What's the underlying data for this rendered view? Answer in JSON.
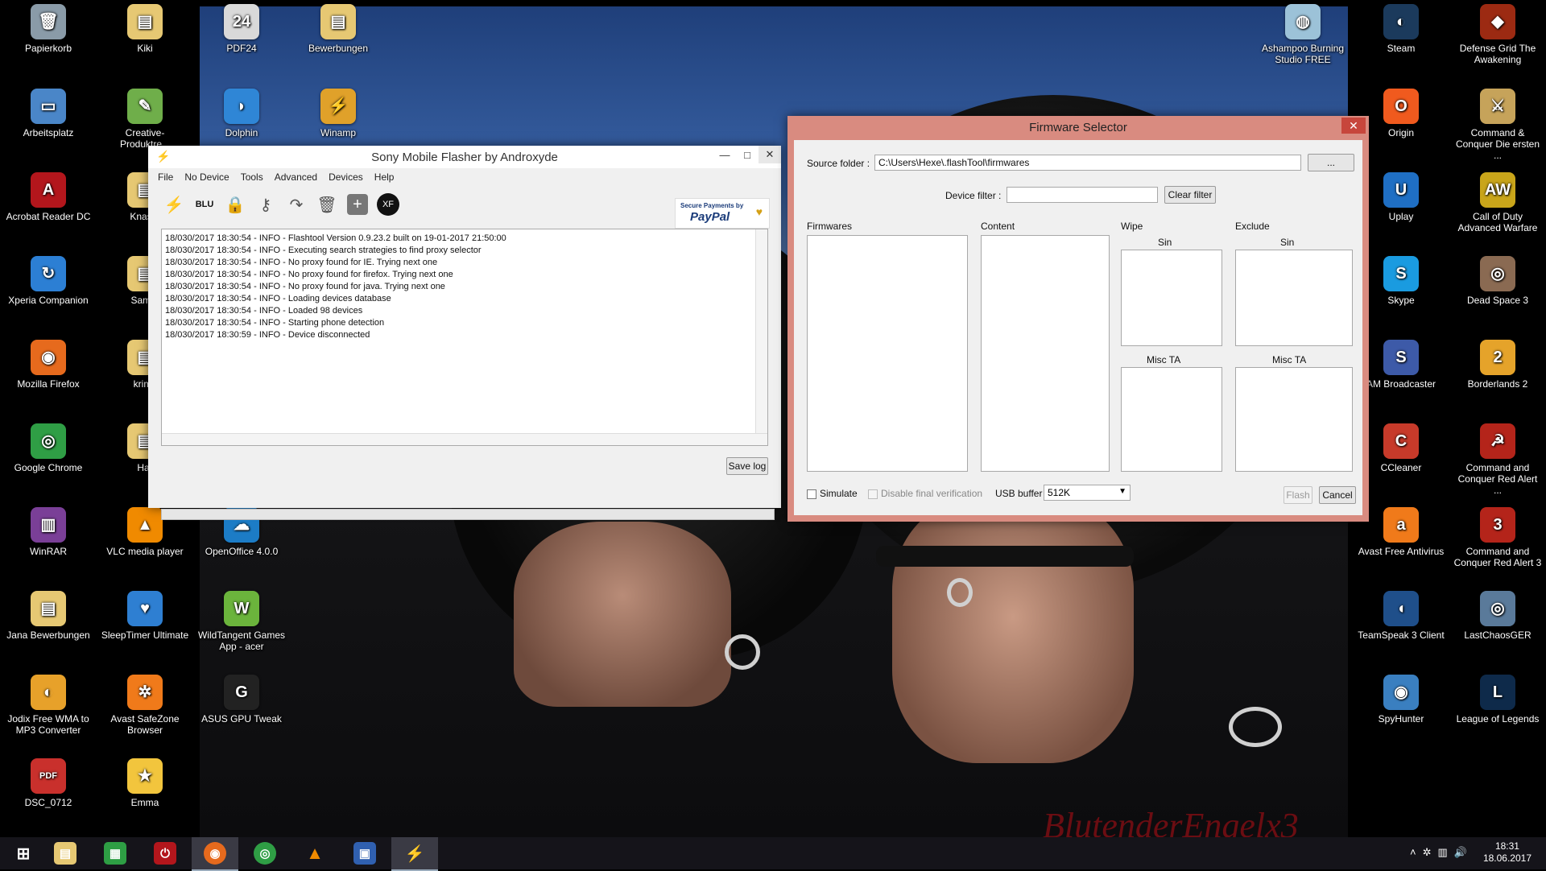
{
  "colors": {
    "accent": "#3d78d6",
    "fw_frame": "#d98b80",
    "close_red": "#c7463c",
    "taskbar": "#15141a"
  },
  "desktop": {
    "watermark": "BlutenderEngelx3",
    "icons_left": [
      {
        "label": "Papierkorb",
        "icon": "recycle-bin-icon",
        "color": "#8a9ba8",
        "glyph": "🗑"
      },
      {
        "label": "Kiki",
        "icon": "folder-icon",
        "color": "#e6c873",
        "glyph": "▤"
      },
      {
        "label": "PDF24",
        "icon": "pdf24-icon",
        "color": "#d9d9d9",
        "glyph": "24"
      },
      {
        "label": "Bewerbungen",
        "icon": "folder-icon",
        "color": "#e6c873",
        "glyph": "▤"
      },
      {
        "label": "Arbeitsplatz",
        "icon": "computer-icon",
        "color": "#4a86c8",
        "glyph": "▭"
      },
      {
        "label": "Creative-Produktre...",
        "icon": "creative-icon",
        "color": "#6fae4a",
        "glyph": "✎"
      },
      {
        "label": "Dolphin",
        "icon": "dolphin-icon",
        "color": "#2f86d6",
        "glyph": "◗"
      },
      {
        "label": "Winamp",
        "icon": "winamp-icon",
        "color": "#e0a12a",
        "glyph": "⚡"
      },
      {
        "label": "Acrobat Reader DC",
        "icon": "acrobat-icon",
        "color": "#b3161c",
        "glyph": "A"
      },
      {
        "label": "Knaste",
        "icon": "folder-icon",
        "color": "#e6c873",
        "glyph": "▤"
      },
      {
        "label": "Xperia Companion",
        "icon": "xperia-icon",
        "color": "#2c7fd4",
        "glyph": "↻"
      },
      {
        "label": "Sam T",
        "icon": "folder-icon",
        "color": "#e6c873",
        "glyph": "▤"
      },
      {
        "label": "Mozilla Firefox",
        "icon": "firefox-icon",
        "color": "#e66a1d",
        "glyph": "◉"
      },
      {
        "label": "krims",
        "icon": "folder-icon",
        "color": "#e6c873",
        "glyph": "▤"
      },
      {
        "label": "Google Chrome",
        "icon": "chrome-icon",
        "color": "#2f9e45",
        "glyph": "◎"
      },
      {
        "label": "Har",
        "icon": "folder-icon",
        "color": "#e6c873",
        "glyph": "▤"
      },
      {
        "label": "WinRAR",
        "icon": "winrar-icon",
        "color": "#7a3f97",
        "glyph": "▥"
      },
      {
        "label": "VLC media player",
        "icon": "vlc-icon",
        "color": "#f08a00",
        "glyph": "▲"
      },
      {
        "label": "OpenOffice 4.0.0",
        "icon": "openoffice-icon",
        "color": "#1c7cc6",
        "glyph": "☁"
      },
      {
        "label": "Jana Bewerbungen",
        "icon": "folder-icon",
        "color": "#e6c873",
        "glyph": "▤"
      },
      {
        "label": "SleepTimer Ultimate",
        "icon": "sleeptimer-icon",
        "color": "#2e7fd2",
        "glyph": "♥"
      },
      {
        "label": "WildTangent Games App - acer",
        "icon": "wildtangent-icon",
        "color": "#6bb43c",
        "glyph": "W"
      },
      {
        "label": "Jodix Free WMA to MP3 Converter",
        "icon": "jodix-icon",
        "color": "#e7a12a",
        "glyph": "◐"
      },
      {
        "label": "Avast SafeZone Browser",
        "icon": "avast-safezone-icon",
        "color": "#f07a1a",
        "glyph": "✲"
      },
      {
        "label": "ASUS GPU Tweak",
        "icon": "gpu-tweak-icon",
        "color": "#222222",
        "glyph": "G"
      },
      {
        "label": "DSC_0712",
        "icon": "pdf-file-icon",
        "color": "#c9302c",
        "glyph": "PDF"
      },
      {
        "label": "Emma",
        "icon": "emma-icon",
        "color": "#f2c53d",
        "glyph": "★"
      }
    ],
    "icons_right": [
      {
        "label": "Ashampoo Burning Studio FREE",
        "icon": "ashampoo-icon",
        "color": "#9cc2d8",
        "glyph": "◍"
      },
      {
        "label": "Steam",
        "icon": "steam-icon",
        "color": "#1b3a5c",
        "glyph": "◐"
      },
      {
        "label": "Defense Grid The Awakening",
        "icon": "defense-grid-icon",
        "color": "#9c2a12",
        "glyph": "◆"
      },
      {
        "label": "Origin",
        "icon": "origin-icon",
        "color": "#f05a1e",
        "glyph": "O"
      },
      {
        "label": "Command & Conquer Die ersten ...",
        "icon": "cnc-icon",
        "color": "#c6a35a",
        "glyph": "⚔"
      },
      {
        "label": "Uplay",
        "icon": "uplay-icon",
        "color": "#1f6fc4",
        "glyph": "U"
      },
      {
        "label": "Call of Duty Advanced Warfare",
        "icon": "cod-icon",
        "color": "#c9a51a",
        "glyph": "AW"
      },
      {
        "label": "Skype",
        "icon": "skype-icon",
        "color": "#1a9be0",
        "glyph": "S"
      },
      {
        "label": "Dead Space 3",
        "icon": "deadspace-icon",
        "color": "#8a6a52",
        "glyph": "◎"
      },
      {
        "label": "AM Broadcaster",
        "icon": "broadcaster-icon",
        "color": "#3d5aa8",
        "glyph": "S"
      },
      {
        "label": "Borderlands 2",
        "icon": "borderlands-icon",
        "color": "#e5a32a",
        "glyph": "2"
      },
      {
        "label": "CCleaner",
        "icon": "ccleaner-icon",
        "color": "#c73a2a",
        "glyph": "C"
      },
      {
        "label": "Command and Conquer Red Alert ...",
        "icon": "red-alert-icon",
        "color": "#b4241a",
        "glyph": "☭"
      },
      {
        "label": "Avast Free Antivirus",
        "icon": "avast-icon",
        "color": "#f07a1a",
        "glyph": "a"
      },
      {
        "label": "Command and Conquer Red Alert 3",
        "icon": "red-alert3-icon",
        "color": "#b4241a",
        "glyph": "3"
      },
      {
        "label": "TeamSpeak 3 Client",
        "icon": "teamspeak-icon",
        "color": "#1f4f8a",
        "glyph": "◖"
      },
      {
        "label": "LastChaosGER",
        "icon": "lastchaos-icon",
        "color": "#5a7a9a",
        "glyph": "◎"
      },
      {
        "label": "SpyHunter",
        "icon": "spyhunter-icon",
        "color": "#3a7fc0",
        "glyph": "◉"
      },
      {
        "label": "League of Legends",
        "icon": "lol-icon",
        "color": "#0e2a4a",
        "glyph": "L"
      }
    ]
  },
  "flasher": {
    "title": "Sony Mobile Flasher by Androxyde",
    "app_icon": "flash-icon",
    "menu": [
      "File",
      "No Device",
      "Tools",
      "Advanced",
      "Devices",
      "Help"
    ],
    "toolbar": [
      "flash-icon",
      "blu-icon",
      "lock-icon",
      "key-icon",
      "arrow-icon",
      "trash-icon",
      "plus-icon",
      "xperifirm-icon"
    ],
    "blu_label": "BLU",
    "paypal_top": "Secure Payments by",
    "paypal_brand": "PayPal",
    "log": [
      "18/030/2017 18:30:54 - INFO  - Flashtool Version 0.9.23.2 built on 19-01-2017 21:50:00",
      "18/030/2017 18:30:54 - INFO  - Executing search strategies to find proxy selector",
      "18/030/2017 18:30:54 - INFO  - No proxy found for IE. Trying next one",
      "18/030/2017 18:30:54 - INFO  - No proxy found for firefox. Trying next one",
      "18/030/2017 18:30:54 - INFO  - No proxy found for java. Trying next one",
      "18/030/2017 18:30:54 - INFO  - Loading devices database",
      "18/030/2017 18:30:54 - INFO  - Loaded 98 devices",
      "18/030/2017 18:30:54 - INFO  - Starting phone detection",
      "18/030/2017 18:30:59 - INFO  - Device disconnected"
    ],
    "save_log": "Save log"
  },
  "firmware": {
    "title": "Firmware Selector",
    "source_label": "Source folder :",
    "source_value": "C:\\Users\\Hexe\\.flashTool\\firmwares",
    "browse": "...",
    "filter_label": "Device filter :",
    "filter_value": "",
    "clear_filter": "Clear filter",
    "firmwares": "Firmwares",
    "content": "Content",
    "wipe": "Wipe",
    "exclude": "Exclude",
    "sin": "Sin",
    "misc_ta": "Misc TA",
    "simulate": "Simulate",
    "disable_verif": "Disable final verification",
    "usb_buffer": "USB buffer",
    "usb_value": "512K",
    "flash": "Flash",
    "cancel": "Cancel"
  },
  "taskbar": {
    "apps": [
      "windows-start-icon",
      "file-explorer-icon",
      "store-icon",
      "power-icon",
      "firefox-icon",
      "chrome-icon",
      "vlc-icon",
      "photo-icon",
      "flashtool-icon"
    ],
    "time": "18:31",
    "date": "18.06.2017"
  }
}
